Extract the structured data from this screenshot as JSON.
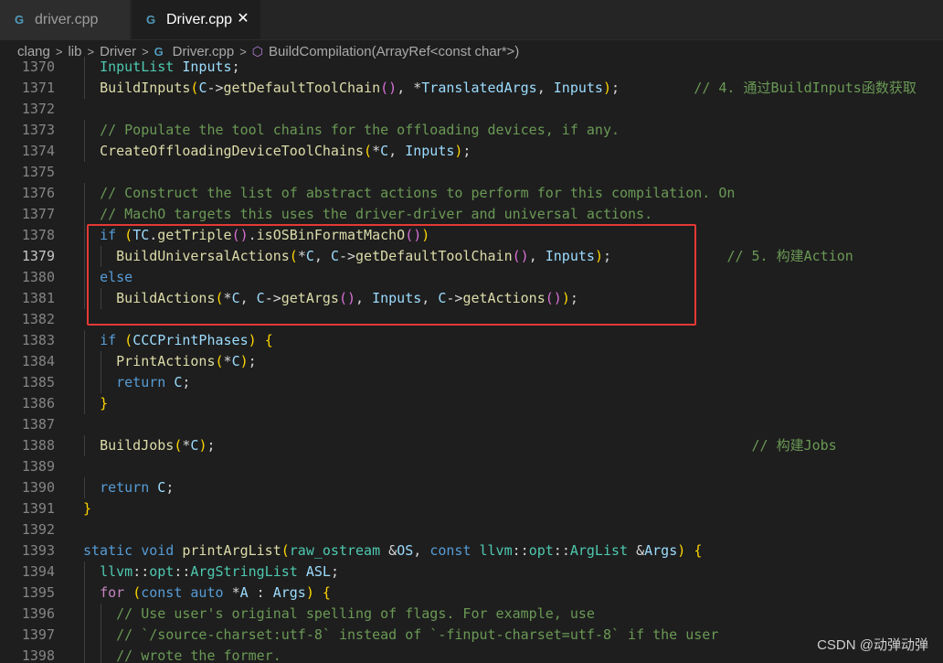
{
  "tabs": [
    {
      "label": "driver.cpp",
      "icon": "cpp-file-icon",
      "active": false
    },
    {
      "label": "Driver.cpp",
      "icon": "cpp-file-icon",
      "active": true,
      "close": "✕"
    }
  ],
  "breadcrumb": {
    "items": [
      "clang",
      "lib",
      "Driver",
      "Driver.cpp",
      "BuildCompilation(ArrayRef<const char*>)"
    ]
  },
  "code": {
    "active_line": "1379",
    "lines": [
      {
        "n": "1370",
        "t": "  InputList Inputs;"
      },
      {
        "n": "1371",
        "t": "  BuildInputs(C->getDefaultToolChain(), *TranslatedArgs, Inputs);         // 4. 通过BuildInputs函数获取"
      },
      {
        "n": "1372",
        "t": ""
      },
      {
        "n": "1373",
        "t": "  // Populate the tool chains for the offloading devices, if any."
      },
      {
        "n": "1374",
        "t": "  CreateOffloadingDeviceToolChains(*C, Inputs);"
      },
      {
        "n": "1375",
        "t": ""
      },
      {
        "n": "1376",
        "t": "  // Construct the list of abstract actions to perform for this compilation. On"
      },
      {
        "n": "1377",
        "t": "  // MachO targets this uses the driver-driver and universal actions."
      },
      {
        "n": "1378",
        "t": "  if (TC.getTriple().isOSBinFormatMachO())"
      },
      {
        "n": "1379",
        "t": "    BuildUniversalActions(*C, C->getDefaultToolChain(), Inputs);              // 5. 构建Action"
      },
      {
        "n": "1380",
        "t": "  else"
      },
      {
        "n": "1381",
        "t": "    BuildActions(*C, C->getArgs(), Inputs, C->getActions());"
      },
      {
        "n": "1382",
        "t": ""
      },
      {
        "n": "1383",
        "t": "  if (CCCPrintPhases) {"
      },
      {
        "n": "1384",
        "t": "    PrintActions(*C);"
      },
      {
        "n": "1385",
        "t": "    return C;"
      },
      {
        "n": "1386",
        "t": "  }"
      },
      {
        "n": "1387",
        "t": ""
      },
      {
        "n": "1388",
        "t": "  BuildJobs(*C);                                                                 // 构建Jobs"
      },
      {
        "n": "1389",
        "t": ""
      },
      {
        "n": "1390",
        "t": "  return C;"
      },
      {
        "n": "1391",
        "t": "}"
      },
      {
        "n": "1392",
        "t": ""
      },
      {
        "n": "1393",
        "t": "static void printArgList(raw_ostream &OS, const llvm::opt::ArgList &Args) {"
      },
      {
        "n": "1394",
        "t": "  llvm::opt::ArgStringList ASL;"
      },
      {
        "n": "1395",
        "t": "  for (const auto *A : Args) {"
      },
      {
        "n": "1396",
        "t": "    // Use user's original spelling of flags. For example, use"
      },
      {
        "n": "1397",
        "t": "    // `/source-charset:utf-8` instead of `-finput-charset=utf-8` if the user"
      },
      {
        "n": "1398",
        "t": "    // wrote the former."
      }
    ]
  },
  "watermark": "CSDN @动弹动弹"
}
